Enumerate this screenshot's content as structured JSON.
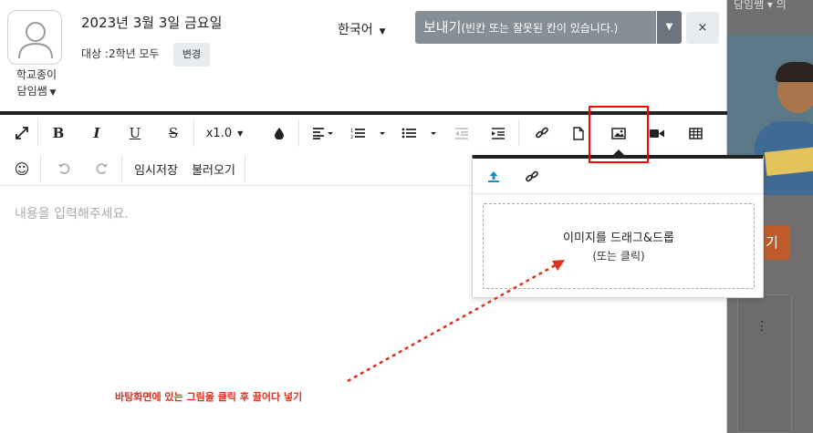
{
  "header": {
    "avatar_name": "학교종이",
    "role": "담임쌤",
    "date_title": "2023년 3월 3일 금요일",
    "target_label": "대상 :2학년 모두",
    "change_button": "변경",
    "language": "한국어",
    "send_label": "보내기",
    "send_note": "(빈칸 또는 잘못된 칸이 있습니다.)",
    "close_symbol": "×"
  },
  "toolbar": {
    "row1": [
      {
        "name": "fullscreen-icon"
      },
      {
        "name": "bold-icon",
        "glyph": "B"
      },
      {
        "name": "italic-icon",
        "glyph": "I"
      },
      {
        "name": "underline-icon",
        "glyph": "U"
      },
      {
        "name": "strikethrough-icon",
        "glyph": "S"
      },
      {
        "name": "line-height-select",
        "glyph": "x1.0"
      },
      {
        "name": "text-color-icon"
      },
      {
        "name": "align-icon"
      },
      {
        "name": "ordered-list-icon"
      },
      {
        "name": "bullet-list-icon"
      },
      {
        "name": "outdent-icon"
      },
      {
        "name": "indent-icon"
      },
      {
        "name": "link-icon"
      },
      {
        "name": "file-icon"
      },
      {
        "name": "image-icon"
      },
      {
        "name": "video-icon"
      },
      {
        "name": "table-icon"
      }
    ],
    "row2": [
      {
        "name": "emoji-icon",
        "glyph": "☺"
      },
      {
        "name": "undo-icon"
      },
      {
        "name": "redo-icon"
      }
    ],
    "temp_save": "임시저장",
    "load": "불러오기"
  },
  "editor": {
    "placeholder": "내용을 입력해주세요."
  },
  "image_popup": {
    "tabs": [
      "upload-icon",
      "link-icon"
    ],
    "drop_main": "이미지를 드래그&드롭",
    "drop_sub": "(또는 클릭)"
  },
  "annotation": {
    "text": "바탕화면에 있는 그림을 클릭 후 끌어다 넣기",
    "color": "#e0301e",
    "highlight_color": "#ff0000"
  },
  "background_page": {
    "nav_text": "담임쌤 ▾  의",
    "button_text": "기"
  },
  "colors": {
    "send_button": "#868e96",
    "send_caret": "#6c757d",
    "accent_blue": "#1b8ac9"
  }
}
